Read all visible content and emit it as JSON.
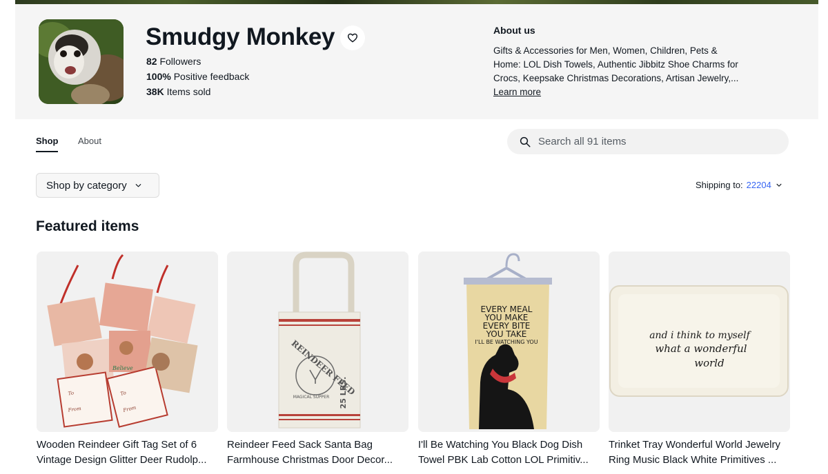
{
  "store": {
    "name": "Smudgy Monkey",
    "followers_count": "82",
    "followers_label": "Followers",
    "feedback_value": "100%",
    "feedback_label": "Positive feedback",
    "items_sold_value": "38K",
    "items_sold_label": "Items sold",
    "favorite_icon": "heart-icon"
  },
  "about": {
    "title": "About us",
    "text_lines": [
      "Gifts & Accessories for Men, Women, Children, Pets &",
      "Home: LOL Dish Towels, Authentic Jibbitz Shoe Charms for",
      "Crocs, Keepsake Christmas Decorations, Artisan Jewelry,..."
    ],
    "learn_more": "Learn more"
  },
  "tabs": [
    {
      "label": "Shop",
      "active": true
    },
    {
      "label": "About",
      "active": false
    }
  ],
  "search": {
    "placeholder": "Search all 91 items",
    "icon": "search-icon"
  },
  "category": {
    "label": "Shop by category",
    "icon": "chevron-down-icon"
  },
  "shipping": {
    "label": "Shipping to:",
    "zip": "22204",
    "zip_color": "#3665f3"
  },
  "featured": {
    "heading": "Featured items",
    "items": [
      {
        "title_lines": [
          "Wooden Reindeer Gift Tag Set of 6",
          "Vintage Design Glitter Deer Rudolp..."
        ],
        "image_text": [
          "Believe",
          "To",
          "From",
          "To",
          "From"
        ]
      },
      {
        "title_lines": [
          "Reindeer Feed Sack Santa Bag",
          "Farmhouse Christmas Door Decor..."
        ],
        "image_text": [
          "REINDEER FEED",
          "MAGICAL SUPPER",
          "25 LBS."
        ]
      },
      {
        "title_lines": [
          "I'll Be Watching You Black Dog Dish",
          "Towel PBK Lab Cotton LOL Primitiv..."
        ],
        "image_text": [
          "EVERY MEAL",
          "YOU MAKE",
          "EVERY BITE",
          "YOU TAKE",
          "I'LL BE WATCHING YOU"
        ]
      },
      {
        "title_lines": [
          "Trinket Tray Wonderful World Jewelry",
          "Ring Music Black White Primitives ..."
        ],
        "image_text": [
          "and i think to myself",
          "what a wonderful",
          "world"
        ]
      }
    ]
  },
  "colors": {
    "header_bg": "#f5f5f5",
    "text": "#111820",
    "link": "#3665f3"
  }
}
